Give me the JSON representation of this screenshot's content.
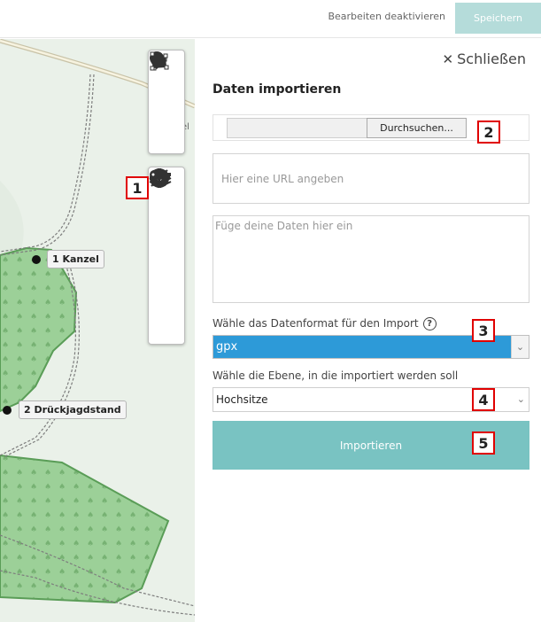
{
  "header": {
    "disable_edit_label": "Bearbeiten deaktivieren",
    "save_label": "Speichern"
  },
  "map": {
    "road_label": "el",
    "features": [
      {
        "label": "1 Kanzel"
      },
      {
        "label": "2 Drückjagdstand"
      }
    ],
    "toolbar": {
      "draw": [
        "marker-icon",
        "polyline-icon",
        "polygon-icon"
      ],
      "tools": [
        "upload-icon",
        "gear-icon",
        "layers-icon",
        "collapse-icon",
        "key-icon"
      ]
    }
  },
  "panel": {
    "close_label": "Schließen",
    "title": "Daten importieren",
    "browse_label": "Durchsuchen...",
    "url_placeholder": "Hier eine URL angeben",
    "data_placeholder": "Füge deine Daten hier ein",
    "format_label": "Wähle das Datenformat für den Import",
    "format_help": "?",
    "format_value": "gpx",
    "layer_label": "Wähle die Ebene, in die importiert werden soll",
    "layer_value": "Hochsitze",
    "import_label": "Importieren"
  },
  "markers": [
    "1",
    "2",
    "3",
    "4",
    "5"
  ],
  "colors": {
    "accent": "#79c3c2",
    "save_button": "#b5dcda",
    "select_highlight": "#2d9ad8",
    "forest": "#8fc58b",
    "marker_border": "#e00000"
  }
}
